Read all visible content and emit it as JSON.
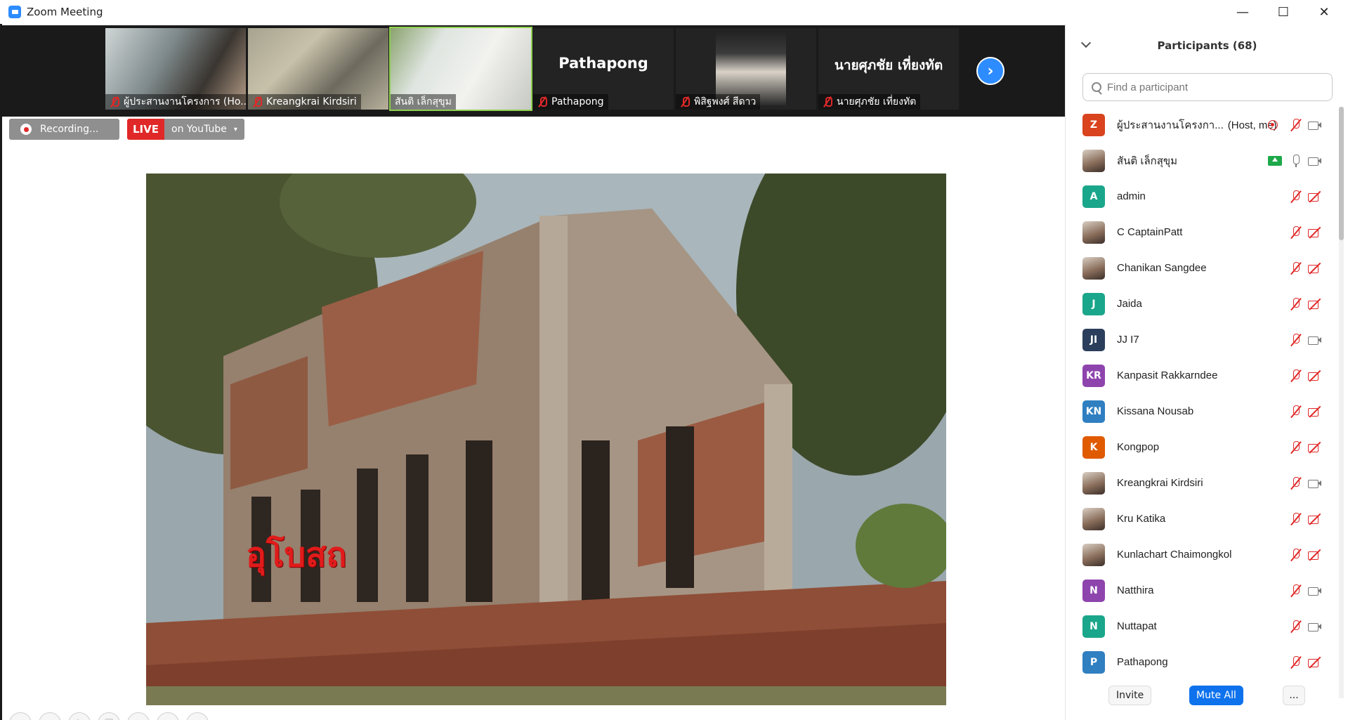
{
  "window": {
    "title": "Zoom Meeting",
    "minimize_glyph": "—",
    "maximize_glyph": "☐",
    "close_glyph": "✕"
  },
  "video_strip": {
    "tiles": [
      {
        "name": "ผู้ประสานงานโครงการ (Ho...",
        "muted": true,
        "big_label": ""
      },
      {
        "name": "Kreangkrai Kirdsiri",
        "muted": true,
        "big_label": ""
      },
      {
        "name": "สันติ เล็กสุขุม",
        "muted": false,
        "active": true,
        "big_label": ""
      },
      {
        "name": "Pathapong",
        "muted": true,
        "big_label": "Pathapong"
      },
      {
        "name": "พิสิฐพงศ์ สีดาว",
        "muted": true,
        "big_label": ""
      },
      {
        "name": "นายศุภชัย  เที่ยงทัต",
        "muted": true,
        "big_label": "นายศุภชัย  เที่ยงทัต"
      }
    ],
    "next_glyph": "›"
  },
  "recording": {
    "label": "Recording..."
  },
  "live": {
    "badge": "LIVE",
    "destination": "on YouTube",
    "caret": "▾"
  },
  "shared_content": {
    "caption": "อุโบสถ"
  },
  "bottom_toolbar": {
    "icons": [
      "back-icon",
      "forward-icon",
      "pen-icon",
      "copy-icon",
      "zoom-icon",
      "subtitles-icon",
      "more-icon"
    ]
  },
  "participants": {
    "title": "Participants (68)",
    "search_placeholder": "Find a participant",
    "list": [
      {
        "name": "ผู้ประสานงานโครงกา...",
        "tag": "(Host, me)",
        "avatar_text": "Z",
        "avatar_color": "#d9431e",
        "recording": true,
        "mic_off": true,
        "cam_off": false
      },
      {
        "name": "สันติ เล็กสุขุม",
        "tag": "",
        "avatar_text": "",
        "avatar_color": "",
        "sharing": true,
        "mic_off": false,
        "cam_off": false
      },
      {
        "name": "admin",
        "tag": "",
        "avatar_text": "A",
        "avatar_color": "#1aa68a",
        "mic_off": true,
        "cam_off": true
      },
      {
        "name": "C CaptainPatt",
        "tag": "",
        "avatar_text": "",
        "avatar_color": "",
        "mic_off": true,
        "cam_off": true
      },
      {
        "name": "Chanikan Sangdee",
        "tag": "",
        "avatar_text": "",
        "avatar_color": "",
        "mic_off": true,
        "cam_off": true
      },
      {
        "name": "Jaida",
        "tag": "",
        "avatar_text": "J",
        "avatar_color": "#1aa68a",
        "mic_off": true,
        "cam_off": true
      },
      {
        "name": "JJ I7",
        "tag": "",
        "avatar_text": "JI",
        "avatar_color": "#2b3f5c",
        "mic_off": true,
        "cam_off": false
      },
      {
        "name": "Kanpasit Rakkarndee",
        "tag": "",
        "avatar_text": "KR",
        "avatar_color": "#8e44ad",
        "mic_off": true,
        "cam_off": true
      },
      {
        "name": "Kissana Nousab",
        "tag": "",
        "avatar_text": "KN",
        "avatar_color": "#2f7fc1",
        "mic_off": true,
        "cam_off": true
      },
      {
        "name": "Kongpop",
        "tag": "",
        "avatar_text": "K",
        "avatar_color": "#e05a00",
        "mic_off": true,
        "cam_off": true
      },
      {
        "name": "Kreangkrai Kirdsiri",
        "tag": "",
        "avatar_text": "",
        "avatar_color": "",
        "mic_off": true,
        "cam_off": false
      },
      {
        "name": "Kru Katika",
        "tag": "",
        "avatar_text": "",
        "avatar_color": "",
        "mic_off": true,
        "cam_off": true
      },
      {
        "name": "Kunlachart Chaimongkol",
        "tag": "",
        "avatar_text": "",
        "avatar_color": "",
        "mic_off": true,
        "cam_off": true
      },
      {
        "name": "Natthira",
        "tag": "",
        "avatar_text": "N",
        "avatar_color": "#8e44ad",
        "mic_off": true,
        "cam_off": false
      },
      {
        "name": "Nuttapat",
        "tag": "",
        "avatar_text": "N",
        "avatar_color": "#1aa68a",
        "mic_off": true,
        "cam_off": false
      },
      {
        "name": "Pathapong",
        "tag": "",
        "avatar_text": "P",
        "avatar_color": "#2f7fc1",
        "mic_off": true,
        "cam_off": true
      }
    ],
    "invite_label": "Invite",
    "mute_all_label": "Mute All",
    "more_label": "..."
  }
}
